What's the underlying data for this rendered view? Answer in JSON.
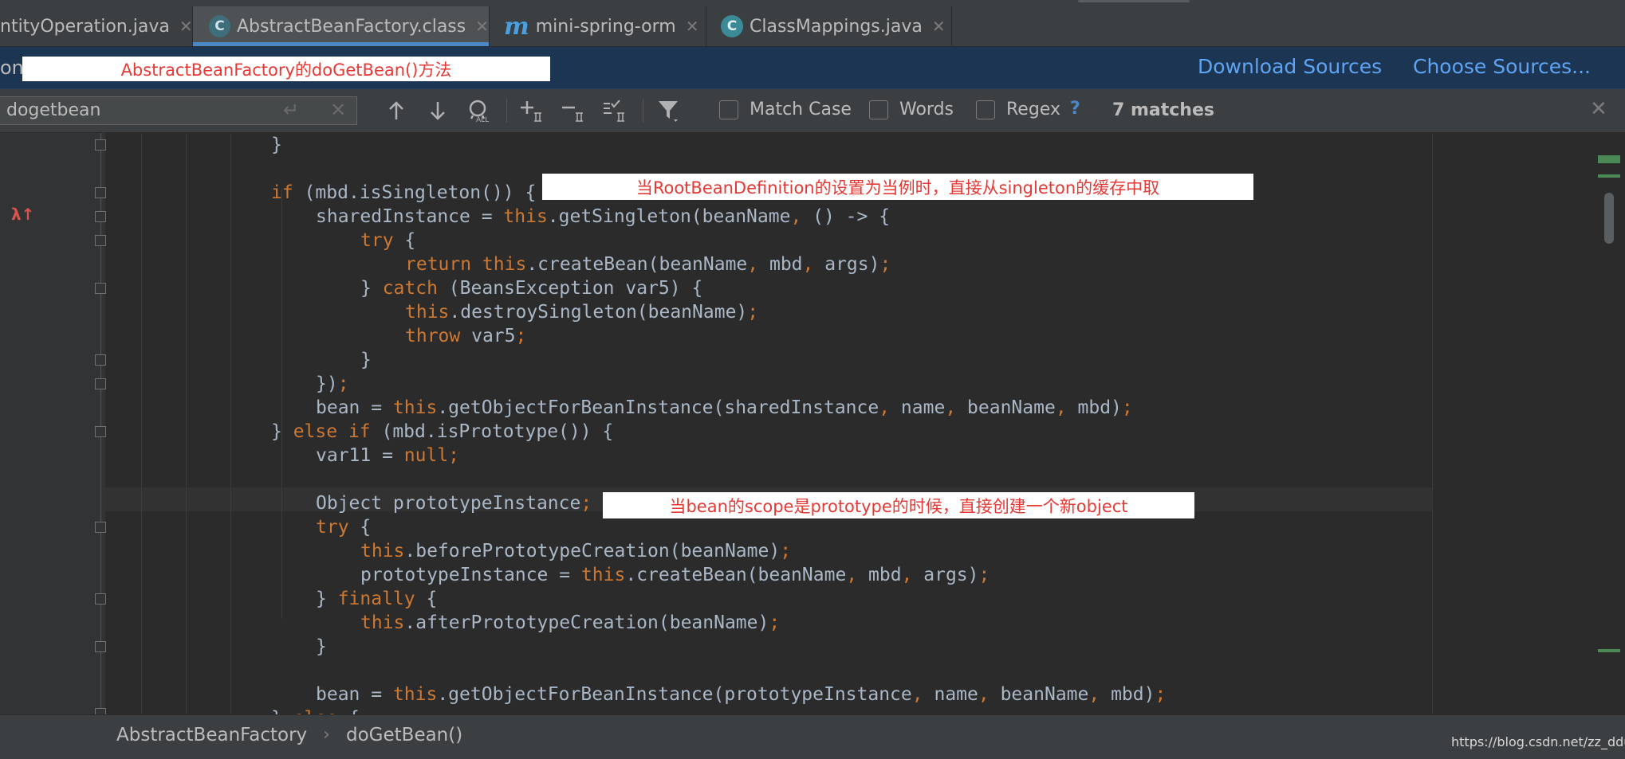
{
  "tabs": [
    {
      "label": "ntityOperation.java",
      "close": "✕",
      "icon": "java-class-icon",
      "active": false
    },
    {
      "label": "AbstractBeanFactory.class",
      "close": "✕",
      "icon": "class-file-icon",
      "active": true,
      "icon_letter": "C"
    },
    {
      "label": "mini-spring-orm",
      "close": "✕",
      "icon": "maven-module-icon",
      "active": false,
      "icon_letter": "m"
    },
    {
      "label": "ClassMappings.java",
      "close": "✕",
      "icon": "java-class-icon",
      "active": false,
      "icon_letter": "C"
    }
  ],
  "banner": {
    "prefix": "on",
    "note": "AbstractBeanFactory的doGetBean()方法",
    "download_sources": "Download Sources",
    "choose_sources": "Choose Sources..."
  },
  "find": {
    "query": "dogetbean",
    "enter_glyph": "↵",
    "clear_glyph": "✕",
    "match_case": "Match Case",
    "words": "Words",
    "regex": "Regex",
    "help": "?",
    "matches": "7 matches",
    "close_glyph": "✕"
  },
  "annotations": {
    "singleton": "当RootBeanDefinition的设置为当例时，直接从singleton的缓存中取",
    "prototype": "当bean的scope是prototype的时候，直接创建一个新object"
  },
  "code": [
    {
      "indent": 0,
      "tokens": [
        [
          "}",
          ""
        ]
      ]
    },
    {
      "indent": 0,
      "tokens": [
        [
          "",
          ""
        ]
      ]
    },
    {
      "indent": 0,
      "tokens": [
        [
          "if",
          "kw"
        ],
        [
          " (mbd.isSingleton()) {",
          ""
        ]
      ]
    },
    {
      "indent": 1,
      "tokens": [
        [
          "sharedInstance = ",
          ""
        ],
        [
          "this",
          "kw"
        ],
        [
          ".getSingleton(beanName",
          ""
        ],
        [
          ",",
          "kw"
        ],
        [
          " () -> {",
          ""
        ]
      ]
    },
    {
      "indent": 2,
      "tokens": [
        [
          "try",
          "kw"
        ],
        [
          " {",
          ""
        ]
      ]
    },
    {
      "indent": 3,
      "tokens": [
        [
          "return this",
          "kw"
        ],
        [
          ".createBean(beanName",
          ""
        ],
        [
          ",",
          "kw"
        ],
        [
          " mbd",
          ""
        ],
        [
          ",",
          "kw"
        ],
        [
          " args)",
          ""
        ],
        [
          ";",
          "kw"
        ]
      ]
    },
    {
      "indent": 2,
      "tokens": [
        [
          "} ",
          ""
        ],
        [
          "catch",
          "kw"
        ],
        [
          " (BeansException var5) {",
          ""
        ]
      ]
    },
    {
      "indent": 3,
      "tokens": [
        [
          "this",
          "kw"
        ],
        [
          ".destroySingleton(beanName)",
          ""
        ],
        [
          ";",
          "kw"
        ]
      ]
    },
    {
      "indent": 3,
      "tokens": [
        [
          "throw",
          "kw"
        ],
        [
          " var5",
          ""
        ],
        [
          ";",
          "kw"
        ]
      ]
    },
    {
      "indent": 2,
      "tokens": [
        [
          "}",
          ""
        ]
      ]
    },
    {
      "indent": 1,
      "tokens": [
        [
          "})",
          ""
        ],
        [
          ";",
          "kw"
        ]
      ]
    },
    {
      "indent": 1,
      "tokens": [
        [
          "bean = ",
          ""
        ],
        [
          "this",
          "kw"
        ],
        [
          ".getObjectForBeanInstance(sharedInstance",
          ""
        ],
        [
          ",",
          "kw"
        ],
        [
          " name",
          ""
        ],
        [
          ",",
          "kw"
        ],
        [
          " beanName",
          ""
        ],
        [
          ",",
          "kw"
        ],
        [
          " mbd)",
          ""
        ],
        [
          ";",
          "kw"
        ]
      ]
    },
    {
      "indent": 0,
      "tokens": [
        [
          "} ",
          ""
        ],
        [
          "else if",
          "kw"
        ],
        [
          " (mbd.isPrototype()) {",
          ""
        ]
      ]
    },
    {
      "indent": 1,
      "tokens": [
        [
          "var11 = ",
          ""
        ],
        [
          "null;",
          "kw"
        ]
      ]
    },
    {
      "indent": 0,
      "tokens": [
        [
          "",
          ""
        ]
      ]
    },
    {
      "indent": 1,
      "tokens": [
        [
          "Object prototypeInstance",
          ""
        ],
        [
          ";",
          "kw"
        ]
      ]
    },
    {
      "indent": 1,
      "tokens": [
        [
          "try",
          "kw"
        ],
        [
          " {",
          ""
        ]
      ]
    },
    {
      "indent": 2,
      "tokens": [
        [
          "this",
          "kw"
        ],
        [
          ".beforePrototypeCreation(beanName)",
          ""
        ],
        [
          ";",
          "kw"
        ]
      ]
    },
    {
      "indent": 2,
      "tokens": [
        [
          "prototypeInstance = ",
          ""
        ],
        [
          "this",
          "kw"
        ],
        [
          ".createBean(beanName",
          ""
        ],
        [
          ",",
          "kw"
        ],
        [
          " mbd",
          ""
        ],
        [
          ",",
          "kw"
        ],
        [
          " args)",
          ""
        ],
        [
          ";",
          "kw"
        ]
      ]
    },
    {
      "indent": 1,
      "tokens": [
        [
          "} ",
          ""
        ],
        [
          "finally",
          "kw"
        ],
        [
          " {",
          ""
        ]
      ]
    },
    {
      "indent": 2,
      "tokens": [
        [
          "this",
          "kw"
        ],
        [
          ".afterPrototypeCreation(beanName)",
          ""
        ],
        [
          ";",
          "kw"
        ]
      ]
    },
    {
      "indent": 1,
      "tokens": [
        [
          "}",
          ""
        ]
      ]
    },
    {
      "indent": 0,
      "tokens": [
        [
          "",
          ""
        ]
      ]
    },
    {
      "indent": 1,
      "tokens": [
        [
          "bean = ",
          ""
        ],
        [
          "this",
          "kw"
        ],
        [
          ".getObjectForBeanInstance(prototypeInstance",
          ""
        ],
        [
          ",",
          "kw"
        ],
        [
          " name",
          ""
        ],
        [
          ",",
          "kw"
        ],
        [
          " beanName",
          ""
        ],
        [
          ",",
          "kw"
        ],
        [
          " mbd)",
          ""
        ],
        [
          ";",
          "kw"
        ]
      ]
    },
    {
      "indent": 0,
      "tokens": [
        [
          "} ",
          ""
        ],
        [
          "else",
          "kw"
        ],
        [
          " {",
          ""
        ]
      ]
    }
  ],
  "breadcrumb": {
    "class": "AbstractBeanFactory",
    "separator": "›",
    "method": "doGetBean()"
  },
  "watermark": "https://blog.csdn.net/zz_ddup",
  "colors": {
    "keyword": "#cc7832",
    "text": "#a9b7c6",
    "link": "#5ea4f2",
    "annotation_text": "#e53935",
    "active_tab_underline": "#4a88c7"
  }
}
